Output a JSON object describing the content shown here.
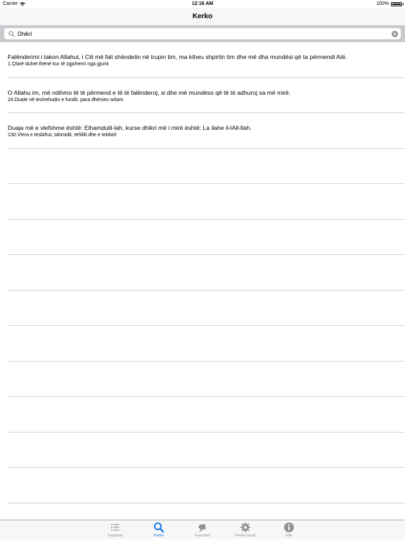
{
  "status_bar": {
    "carrier": "Carrier",
    "time": "12:16 AM",
    "battery": "100%"
  },
  "nav": {
    "title": "Kerko"
  },
  "search": {
    "value": "Dhikri",
    "placeholder": ""
  },
  "results": [
    {
      "title": "Falënderimi i takon Allahut, i Cili më fali shëndetin në trupin tim, ma ktheu shpirtin tim dhe më dha mundësi që ta përmendi Atë.",
      "subtitle": "1.Çfarë duhet thënë kur të zgjohemi nga gjumi"
    },
    {
      "title": "O Allahu im, më ndihmo të të përmend e të të falënderoj, si dhe më mundëso që të të adhuroj sa më mirë.",
      "subtitle": "24.Duatë në teshehudin e fundit, para dhënies selam"
    },
    {
      "title": "Duaja më e vlefshme është: Elhamdulil-lah, kurse dhikri më i mirë është: La ilahe il-lAll-llah.",
      "subtitle": "130.Vlera e tesbihut, tahmidit, tehlilit dhe e tekbirit"
    }
  ],
  "empty_rows": 10,
  "tabs": [
    {
      "label": "Kaptinat",
      "icon": "list-icon",
      "active": false
    },
    {
      "label": "Kerko",
      "icon": "search-icon",
      "active": true
    },
    {
      "label": "Favoritet",
      "icon": "bookmark-icon",
      "active": false
    },
    {
      "label": "Preferencat",
      "icon": "gear-icon",
      "active": false
    },
    {
      "label": "Info",
      "icon": "info-icon",
      "active": false
    }
  ],
  "colors": {
    "accent": "#1a7ae8",
    "inactive": "#929292",
    "search_bar_bg": "#c9c9ce"
  }
}
